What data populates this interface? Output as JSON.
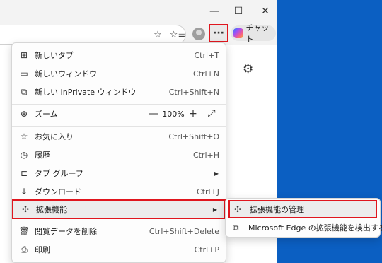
{
  "window": {
    "minimize_icon": "minimize-icon",
    "maximize_icon": "maximize-icon",
    "close_icon": "close-icon"
  },
  "toolbar": {
    "more_label": "···",
    "copilot_label": "チャット"
  },
  "menu": {
    "items": [
      {
        "label": "新しいタブ",
        "shortcut": "Ctrl+T",
        "icon": "new-tab-icon"
      },
      {
        "label": "新しいウィンドウ",
        "shortcut": "Ctrl+N",
        "icon": "new-window-icon"
      },
      {
        "label": "新しい InPrivate ウィンドウ",
        "shortcut": "Ctrl+Shift+N",
        "icon": "inprivate-icon"
      },
      {
        "label": "ズーム",
        "zoom": "100%",
        "icon": "zoom-icon"
      },
      {
        "label": "お気に入り",
        "shortcut": "Ctrl+Shift+O",
        "icon": "favorites-icon"
      },
      {
        "label": "履歴",
        "shortcut": "Ctrl+H",
        "icon": "history-icon"
      },
      {
        "label": "タブ グループ",
        "icon": "tab-groups-icon"
      },
      {
        "label": "ダウンロード",
        "shortcut": "Ctrl+J",
        "icon": "download-icon"
      },
      {
        "label": "拡張機能",
        "icon": "extensions-icon"
      },
      {
        "label": "閲覧データを削除",
        "shortcut": "Ctrl+Shift+Delete",
        "icon": "delete-data-icon"
      },
      {
        "label": "印刷",
        "shortcut": "Ctrl+P",
        "icon": "print-icon"
      }
    ]
  },
  "submenu": {
    "items": [
      {
        "label": "拡張機能の管理",
        "icon": "extensions-icon"
      },
      {
        "label": "Microsoft Edge の拡張機能を検出する",
        "icon": "edge-icon"
      }
    ]
  },
  "colors": {
    "highlight": "#e0161e",
    "desktop": "#0b5fc2"
  }
}
